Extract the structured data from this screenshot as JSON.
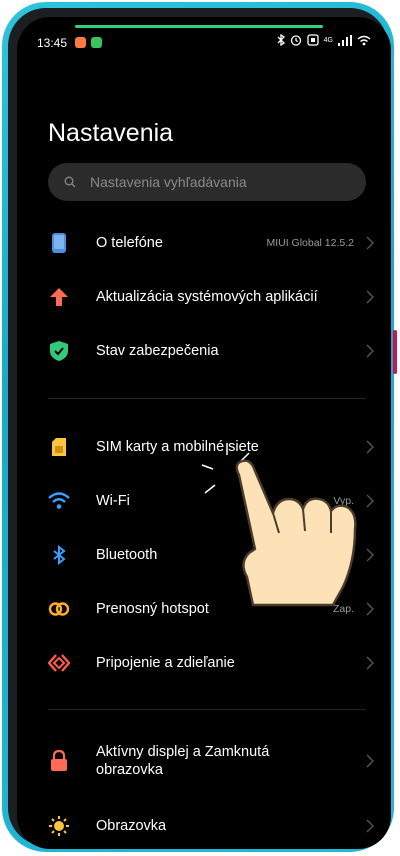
{
  "status_bar": {
    "time": "13:45",
    "network": "4G"
  },
  "page": {
    "title": "Nastavenia"
  },
  "search": {
    "placeholder": "Nastavenia vyhľadávania"
  },
  "items": [
    {
      "label": "O telefóne",
      "value": "MIUI Global 12.5.2",
      "icon": "phone-icon",
      "color": "#4a90e2"
    },
    {
      "label": "Aktualizácia systémových aplikácií",
      "value": "",
      "icon": "arrow-up-icon",
      "color": "#ff6b55"
    },
    {
      "label": "Stav zabezpečenia",
      "value": "",
      "icon": "shield-check-icon",
      "color": "#33c97a"
    },
    {
      "label": "SIM karty a mobilné siete",
      "value": "",
      "icon": "sim-card-icon",
      "color": "#ffc43d"
    },
    {
      "label": "Wi-Fi",
      "value": "Vyp.",
      "icon": "wifi-icon",
      "color": "#3aa0ff"
    },
    {
      "label": "Bluetooth",
      "value": "",
      "icon": "bluetooth-icon",
      "color": "#3aa0ff"
    },
    {
      "label": "Prenosný hotspot",
      "value": "Zap.",
      "icon": "hotspot-icon",
      "color": "#ffb020"
    },
    {
      "label": "Pripojenie a zdieľanie",
      "value": "",
      "icon": "connection-sharing-icon",
      "color": "#ff5a4f"
    },
    {
      "label": "Aktívny displej a Zamknutá obrazovka",
      "value": "",
      "icon": "lock-icon",
      "color": "#ff6b55"
    },
    {
      "label": "Obrazovka",
      "value": "",
      "icon": "brightness-icon",
      "color": "#ffc43d"
    }
  ]
}
